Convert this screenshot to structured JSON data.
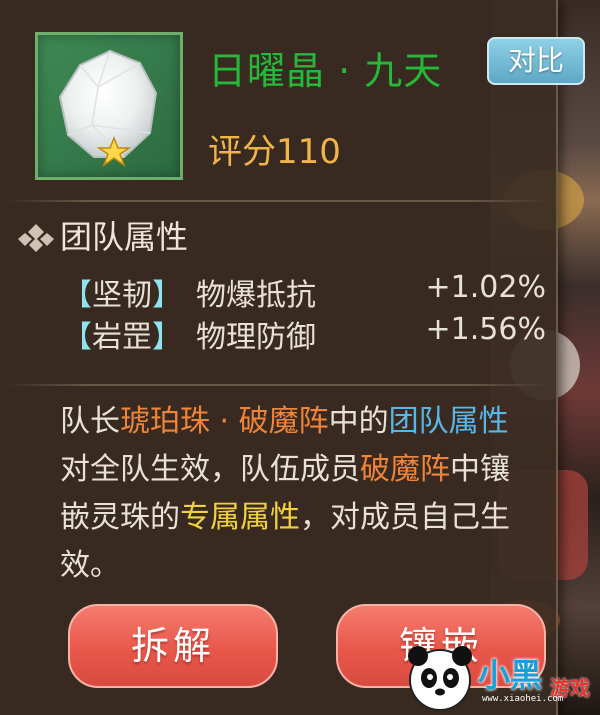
{
  "item": {
    "icon": "white-crystal-icon",
    "name": "日曜晶 · 九天",
    "score": "评分110"
  },
  "compare_label": "对比",
  "section": {
    "icon": "diamond-bullet-icon",
    "title": "团队属性"
  },
  "attributes": [
    {
      "open": "【",
      "tag": "坚韧",
      "close": "】",
      "name": "物爆抵抗",
      "value": "+1.02%"
    },
    {
      "open": "【",
      "tag": "岩罡",
      "close": "】",
      "name": "物理防御",
      "value": "+1.56%"
    }
  ],
  "description": {
    "p1": "队长",
    "p2": "琥珀珠 · 破魔阵",
    "p3": "中的",
    "p4": "团队属性",
    "p5": "对全队生效，队伍成员",
    "p6": "破魔阵",
    "p7": "中镶嵌灵珠的",
    "p8": "专属属性",
    "p9": "，对成员自己生效。"
  },
  "buttons": {
    "dismantle": "拆解",
    "inlay": "镶嵌"
  },
  "watermark": {
    "logo": "panda-logo-icon",
    "brand": "小黑",
    "sub": "游戏",
    "url": "www.xiaohei.com"
  },
  "colors": {
    "name_green": "#27b83a",
    "score_orange": "#f0b44a",
    "highlight_orange": "#f0843a",
    "highlight_blue": "#5ab6e6",
    "highlight_yellow": "#f2d23c",
    "bracket_cyan": "#8fe3ee",
    "button_red": "#e9574b",
    "compare_blue": "#6fb6d4"
  }
}
